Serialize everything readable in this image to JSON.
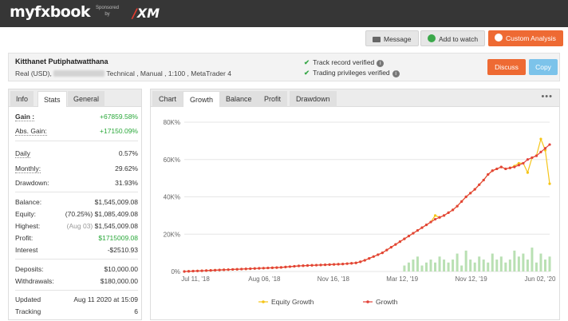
{
  "header": {
    "logo": "myfxbook",
    "sponsor_line1": "Sponsored",
    "sponsor_line2": "by",
    "sponsor_brand": "XM"
  },
  "actions": {
    "message": "Message",
    "add_to_watch": "Add to watch",
    "custom_analysis": "Custom Analysis"
  },
  "account": {
    "name": "Kitthanet Putiphatwatthana",
    "details_prefix": "Real (USD),",
    "details_suffix": "Technical , Manual , 1:100 , MetaTrader 4",
    "verified_track": "Track record verified",
    "verified_privileges": "Trading privileges verified",
    "discuss": "Discuss",
    "copy": "Copy"
  },
  "stats_tabs": [
    "Info",
    "Stats",
    "General"
  ],
  "stats": {
    "gain_label": "Gain :",
    "gain_value": "+67859.58%",
    "abs_gain_label": "Abs. Gain:",
    "abs_gain_value": "+17150.09%",
    "daily_label": "Daily",
    "daily_value": "0.57%",
    "monthly_label": "Monthly:",
    "monthly_value": "29.62%",
    "drawdown_label": "Drawdown:",
    "drawdown_value": "31.93%",
    "balance_label": "Balance:",
    "balance_value": "$1,545,009.08",
    "equity_label": "Equity:",
    "equity_pct": "(70.25%)",
    "equity_value": "$1,085,409.08",
    "highest_label": "Highest:",
    "highest_date": "(Aug 03)",
    "highest_value": "$1,545,009.08",
    "profit_label": "Profit:",
    "profit_value": "$1715009.08",
    "interest_label": "Interest",
    "interest_value": "-$2510.93",
    "deposits_label": "Deposits:",
    "deposits_value": "$10,000.00",
    "withdrawals_label": "Withdrawals:",
    "withdrawals_value": "$180,000.00",
    "updated_label": "Updated",
    "updated_value": "Aug 11 2020 at 15:09",
    "tracking_label": "Tracking",
    "tracking_value": "6"
  },
  "chart_tabs": [
    "Chart",
    "Growth",
    "Balance",
    "Profit",
    "Drawdown"
  ],
  "chart_menu": "•••",
  "colors": {
    "growth": "#e2423a",
    "equity": "#f5c518",
    "bars": "#b9e0b3",
    "grid": "#e6e6e6"
  },
  "chart_data": {
    "type": "line",
    "ytick_labels": [
      "0%",
      "20K%",
      "40K%",
      "60K%",
      "80K%"
    ],
    "ylim": [
      0,
      80000
    ],
    "xtick_labels": [
      "Jul 11, '18",
      "Aug 06, '18",
      "Nov 16, '18",
      "Mar 12, '19",
      "Nov 12, '19",
      "Jun 02, '20"
    ],
    "series": [
      {
        "name": "Growth",
        "values": [
          0,
          100,
          200,
          300,
          400,
          500,
          600,
          700,
          800,
          900,
          1000,
          1100,
          1200,
          1300,
          1400,
          1500,
          1600,
          1700,
          1800,
          1900,
          2000,
          2100,
          2200,
          2400,
          2600,
          2800,
          3000,
          3100,
          3200,
          3300,
          3400,
          3500,
          3600,
          3700,
          3800,
          3900,
          4000,
          4200,
          4400,
          4600,
          5200,
          6000,
          7000,
          8000,
          9000,
          10000,
          11500,
          13000,
          14500,
          16000,
          17500,
          19000,
          20500,
          22000,
          23500,
          25000,
          26500,
          28000,
          29000,
          30000,
          31500,
          33000,
          35000,
          37500,
          40000,
          42000,
          44000,
          46500,
          49000,
          52000,
          54000,
          55000,
          56000,
          55000,
          55500,
          56000,
          57000,
          58000,
          60000,
          61000,
          62000,
          64000,
          66000,
          68000
        ]
      },
      {
        "name": "Equity Growth",
        "values": [
          0,
          100,
          200,
          300,
          400,
          500,
          600,
          700,
          800,
          900,
          1000,
          1100,
          1200,
          1300,
          1400,
          1500,
          1600,
          1700,
          1800,
          1900,
          2000,
          2100,
          2200,
          2400,
          2600,
          2800,
          3000,
          3100,
          3200,
          3300,
          3400,
          3500,
          3600,
          3700,
          3800,
          3900,
          4000,
          4200,
          4400,
          4600,
          5200,
          6000,
          7000,
          8000,
          9000,
          10000,
          11500,
          13000,
          14500,
          16000,
          17500,
          19000,
          20500,
          22000,
          23500,
          25000,
          26500,
          30000,
          29000,
          30000,
          31500,
          33000,
          35000,
          37500,
          40000,
          42000,
          44000,
          46500,
          49000,
          52000,
          54000,
          55000,
          56000,
          55000,
          55500,
          56500,
          58000,
          58000,
          53000,
          61000,
          62000,
          71000,
          65000,
          47000
        ]
      }
    ],
    "bars": [
      0,
      0,
      0,
      0,
      0,
      0,
      0,
      0,
      0,
      0,
      0,
      0,
      0,
      0,
      0,
      0,
      0,
      0,
      0,
      0,
      0,
      0,
      0,
      0,
      0,
      0,
      0,
      0,
      0,
      0,
      0,
      0,
      0,
      0,
      0,
      0,
      0,
      0,
      0,
      0,
      0,
      0,
      0,
      0,
      0,
      0,
      0,
      0,
      0,
      0,
      2,
      3,
      4,
      5,
      2,
      3,
      4,
      3,
      5,
      4,
      3,
      4,
      6,
      2,
      7,
      4,
      3,
      5,
      4,
      3,
      6,
      4,
      5,
      3,
      4,
      7,
      5,
      6,
      4,
      8,
      3,
      6,
      4,
      5
    ],
    "legend": [
      "Equity Growth",
      "Growth"
    ]
  }
}
